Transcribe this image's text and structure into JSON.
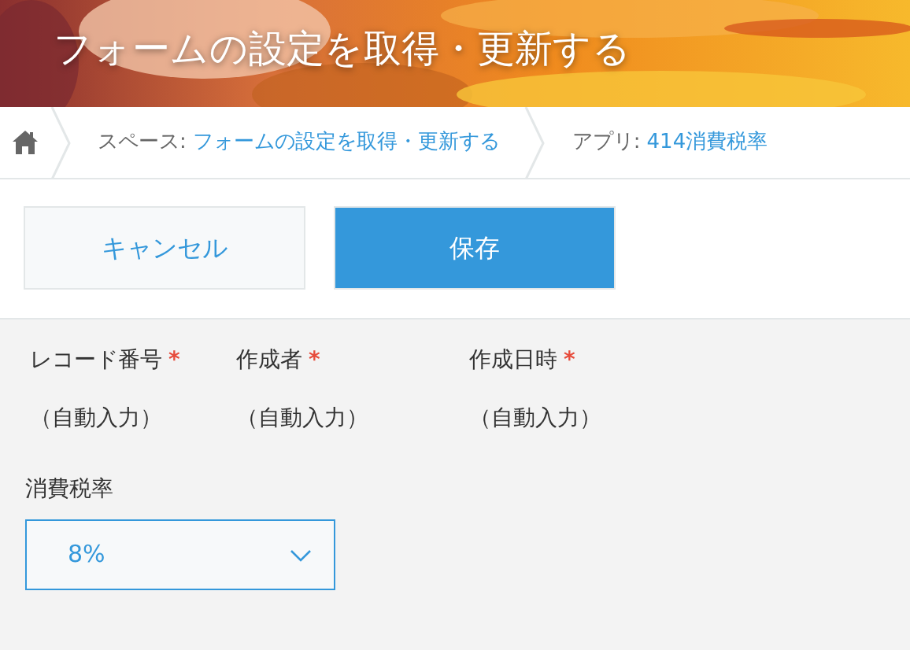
{
  "header": {
    "title": "フォームの設定を取得・更新する"
  },
  "breadcrumb": [
    {
      "prefix": "スペース:",
      "link": "フォームの設定を取得・更新する"
    },
    {
      "prefix": "アプリ:",
      "link": "414消費税率"
    }
  ],
  "buttons": [
    {
      "label": "キャンセル",
      "kind": "secondary"
    },
    {
      "label": "保存",
      "kind": "primary"
    }
  ],
  "fields": [
    {
      "label": "レコード番号",
      "required": true,
      "value": "（自動入力）"
    },
    {
      "label": "作成者",
      "required": true,
      "value": "（自動入力）"
    },
    {
      "label": "作成日時",
      "required": true,
      "value": "（自動入力）"
    }
  ],
  "required_mark": "*",
  "dropdown": {
    "label": "消費税率",
    "value": "8%"
  }
}
